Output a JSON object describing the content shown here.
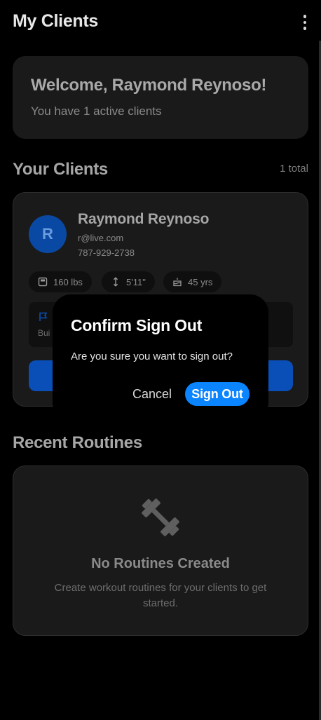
{
  "header": {
    "title": "My Clients",
    "menu_icon": "more-vertical-icon"
  },
  "welcome": {
    "title": "Welcome, Raymond Reynoso!",
    "subtitle": "You have 1 active clients"
  },
  "clients_section": {
    "title": "Your Clients",
    "total": "1 total",
    "clients": [
      {
        "initial": "R",
        "name": "Raymond Reynoso",
        "email": "r@live.com",
        "phone": "787-929-2738",
        "weight": "160 lbs",
        "height": "5'11\"",
        "age": "45 yrs",
        "goal_partial": "Bui"
      }
    ]
  },
  "routines_section": {
    "title": "Recent Routines",
    "empty_icon": "dumbbell-icon",
    "empty_title": "No Routines Created",
    "empty_description": "Create workout routines for your clients to get started."
  },
  "dialog": {
    "title": "Confirm Sign Out",
    "message": "Are you sure you want to sign out?",
    "cancel_label": "Cancel",
    "confirm_label": "Sign Out"
  },
  "colors": {
    "background": "#000000",
    "card": "#1a1a1a",
    "accent": "#0a84ff",
    "avatar": "#0a49a3"
  }
}
